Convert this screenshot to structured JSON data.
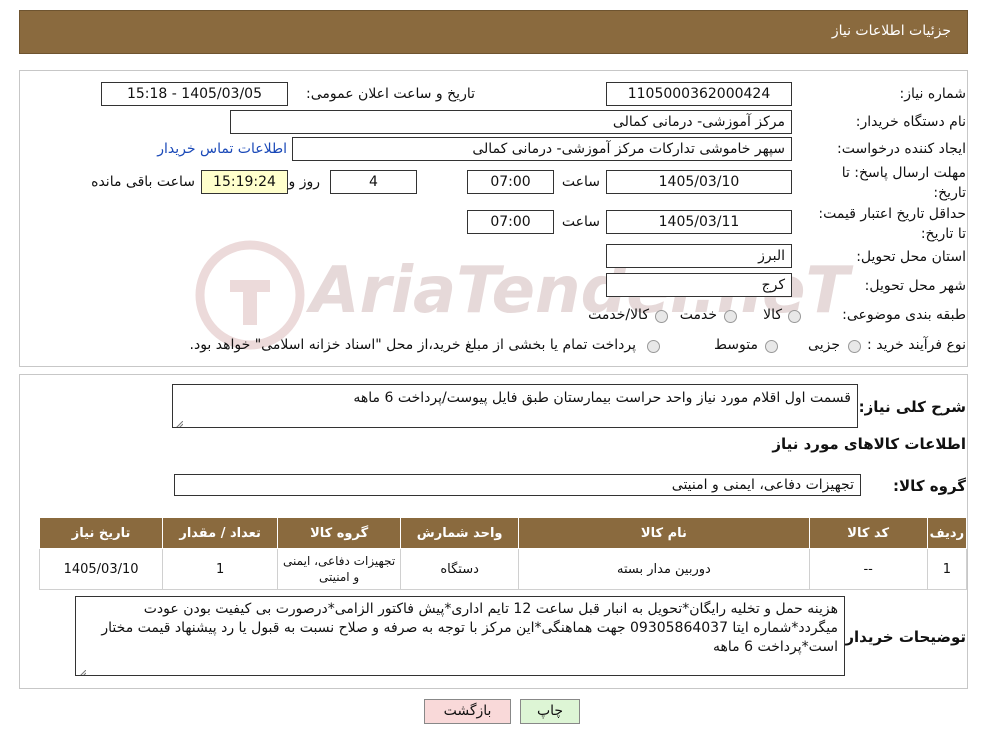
{
  "header": {
    "title": "جزئیات اطلاعات نیاز"
  },
  "watermark": {
    "text": "AriaTender.neT"
  },
  "form": {
    "need_number_label": "شماره نیاز:",
    "need_number": "1105000362000424",
    "announce_label": "تاریخ و ساعت اعلان عمومی:",
    "announce_value": "1405/03/05 - 15:18",
    "buyer_org_label": "نام دستگاه خریدار:",
    "buyer_org": "مرکز آموزشی- درمانی کمالی",
    "requester_label": "ایجاد کننده درخواست:",
    "requester": "سپهر خاموشی تدارکات مرکز آموزشی- درمانی کمالی",
    "contact_link": "اطلاعات تماس خریدار",
    "deadline_label": "مهلت ارسال پاسخ: تا تاریخ:",
    "deadline_date": "1405/03/10",
    "time_label": "ساعت",
    "deadline_time": "07:00",
    "days_value": "4",
    "days_label": "روز و",
    "remaining_time": "15:19:24",
    "remaining_label": "ساعت باقی مانده",
    "validity_label": "حداقل تاریخ اعتبار قیمت: تا تاریخ:",
    "validity_date": "1405/03/11",
    "validity_time": "07:00",
    "province_label": "استان محل تحویل:",
    "province": "البرز",
    "city_label": "شهر محل تحویل:",
    "city": "کرج",
    "category_label": "طبقه بندی موضوعی:",
    "category_options": [
      "کالا",
      "خدمت",
      "کالا/خدمت"
    ],
    "process_label": "نوع فرآیند خرید :",
    "process_options": [
      "جزیی",
      "متوسط"
    ],
    "process_note": "پرداخت تمام یا بخشی از مبلغ خرید،از محل \"اسناد خزانه اسلامی\" خواهد بود."
  },
  "summary": {
    "label": "شرح کلی نیاز:",
    "text": "قسمت اول اقلام مورد نیاز واحد حراست بیمارستان طبق فایل پیوست/پرداخت 6 ماهه",
    "goods_info_title": "اطلاعات کالاهای مورد نیاز",
    "group_label": "گروه کالا:",
    "group_value": "تجهیزات دفاعی، ایمنی و امنیتی"
  },
  "table": {
    "headers": [
      "ردیف",
      "کد کالا",
      "نام کالا",
      "واحد شمارش",
      "گروه کالا",
      "تعداد / مقدار",
      "تاریخ نیاز"
    ],
    "rows": [
      [
        "1",
        "--",
        "دوربین مدار بسته",
        "دستگاه",
        "تجهیزات دفاعی، ایمنی و امنیتی",
        "1",
        "1405/03/10"
      ]
    ]
  },
  "buyer_notes": {
    "label": "توضیحات خریدار:",
    "text": "هزینه حمل و تخلیه رایگان*تحویل به انبار قبل ساعت 12 تایم اداری*پیش فاکتور الزامی*درصورت بی کیفیت بودن عودت میگردد*شماره ایتا 09305864037 جهت هماهنگی*این مرکز با توجه به صرفه و صلاح نسبت به قبول یا رد پیشنهاد قیمت مختار است*پرداخت 6 ماهه"
  },
  "buttons": {
    "print": "چاپ",
    "back": "بازگشت"
  },
  "colors": {
    "header_bg": "#8a6a3e",
    "back_bg": "#f9d9d9",
    "print_bg": "#ddf5d5",
    "link": "#1a49b8"
  }
}
